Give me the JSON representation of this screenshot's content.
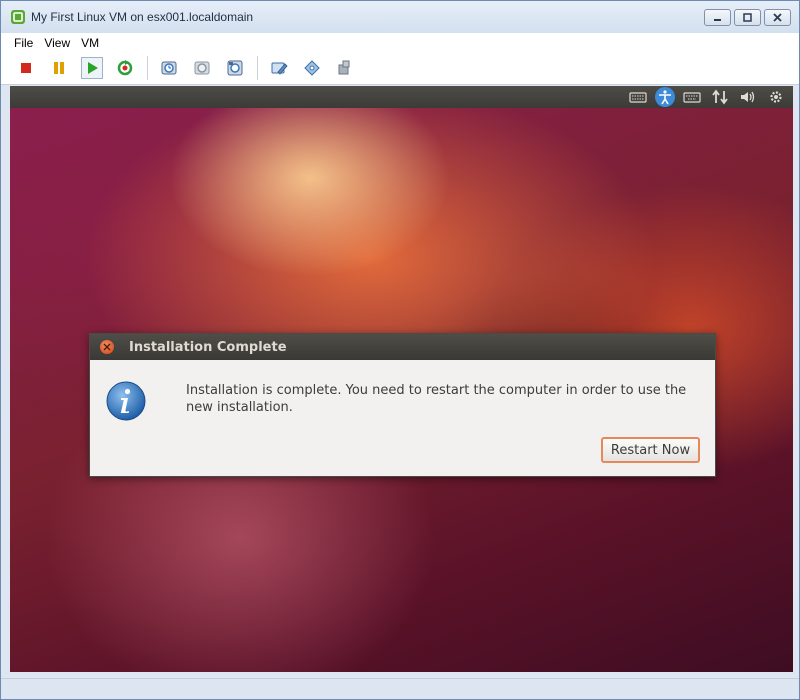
{
  "window": {
    "title": "My First Linux VM on esx001.localdomain",
    "app_icon": "vsphere-console-icon",
    "controls": [
      "minimize-icon",
      "restore-icon",
      "close-icon"
    ]
  },
  "menu": {
    "items": [
      {
        "label": "File"
      },
      {
        "label": "View"
      },
      {
        "label": "VM"
      }
    ]
  },
  "toolbar": {
    "buttons": [
      {
        "icon": "power-off-icon",
        "color": "#d42a1e"
      },
      {
        "icon": "suspend-icon",
        "color": "#e0a000"
      },
      {
        "icon": "power-on-icon",
        "color": "#28a428"
      },
      {
        "icon": "reset-icon",
        "color": "#2e9e3a"
      },
      {
        "icon": "snapshot-icon"
      },
      {
        "icon": "revert-snapshot-icon"
      },
      {
        "icon": "snapshot-manager-icon"
      },
      {
        "icon": "edit-settings-icon"
      },
      {
        "icon": "cd-dvd-icon"
      },
      {
        "icon": "usb-icon"
      }
    ]
  },
  "guest_panel": {
    "indicators": [
      "keyboard-icon",
      "accessibility-icon",
      "keyboard-layout-icon",
      "network-icon",
      "volume-icon",
      "gear-icon"
    ],
    "active_color": "#3c8ad8"
  },
  "dialog": {
    "title": "Installation Complete",
    "message": "Installation is complete. You need to restart the computer in order to use the new installation.",
    "button_label": "Restart Now",
    "icon": "info-icon",
    "accent_color": "#e8875a"
  }
}
